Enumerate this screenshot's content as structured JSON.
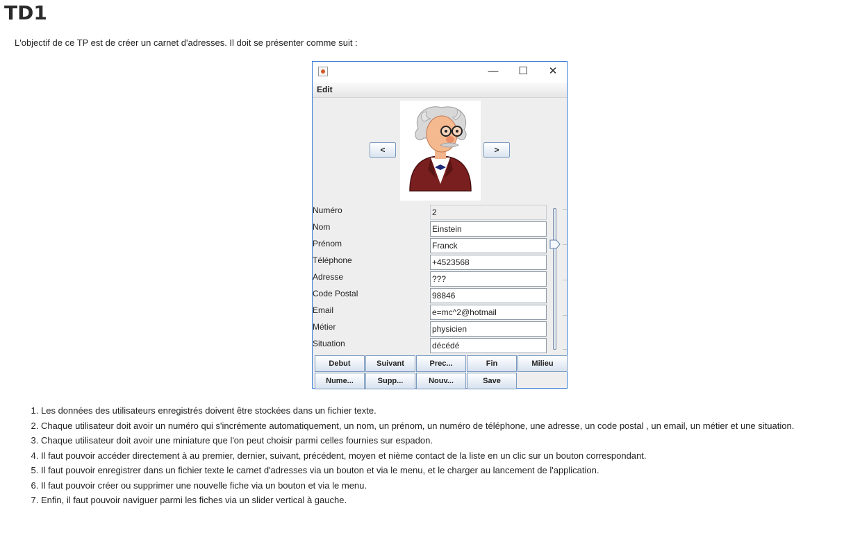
{
  "page": {
    "title": "TD1",
    "intro": "L'objectif de ce TP est de créer un carnet d'adresses. Il doit se présenter comme suit :"
  },
  "window": {
    "icon": "java-cup-icon",
    "controls": {
      "minimize": "—",
      "maximize": "☐",
      "close": "✕"
    },
    "menu": [
      "Edit"
    ],
    "nav": {
      "prev": "<",
      "next": ">"
    },
    "avatar": "einstein-avatar",
    "form": {
      "fields": [
        {
          "label": "Numéro",
          "value": "2",
          "readonly": true
        },
        {
          "label": "Nom",
          "value": "Einstein"
        },
        {
          "label": "Prénom",
          "value": "Franck"
        },
        {
          "label": "Téléphone",
          "value": "+4523568"
        },
        {
          "label": "Adresse",
          "value": "???"
        },
        {
          "label": "Code Postal",
          "value": "98846"
        },
        {
          "label": "Email",
          "value": "e=mc^2@hotmail"
        },
        {
          "label": "Métier",
          "value": "physicien"
        },
        {
          "label": "Situation",
          "value": "décédé"
        }
      ]
    },
    "slider": {
      "orientation": "vertical"
    },
    "buttons": {
      "row1": [
        "Debut",
        "Suivant",
        "Prec...",
        "Fin",
        "Milieu"
      ],
      "row2": [
        "Nume...",
        "Supp...",
        "Nouv...",
        "Save"
      ]
    }
  },
  "requirements": [
    "Les données des utilisateurs enregistrés doivent être stockées dans un fichier texte.",
    "Chaque utilisateur doit avoir un numéro qui s'incrémente automatiquement, un nom, un prénom, un numéro de téléphone, une adresse, un code postal , un email, un métier et une situation.",
    "Chaque utilisateur doit avoir une miniature que l'on peut choisir parmi celles fournies sur espadon.",
    "Il faut pouvoir accéder directement à au premier, dernier, suivant, précédent, moyen et nième contact de la liste en un clic sur un bouton correspondant.",
    "Il faut pouvoir enregistrer dans un fichier texte le carnet d'adresses via un bouton et via le menu, et le charger au lancement de l'application.",
    "Il faut pouvoir créer ou supprimer une nouvelle fiche  via un bouton et via le menu.",
    "Enfin, il faut pouvoir naviguer parmi les fiches via un slider vertical à gauche."
  ]
}
